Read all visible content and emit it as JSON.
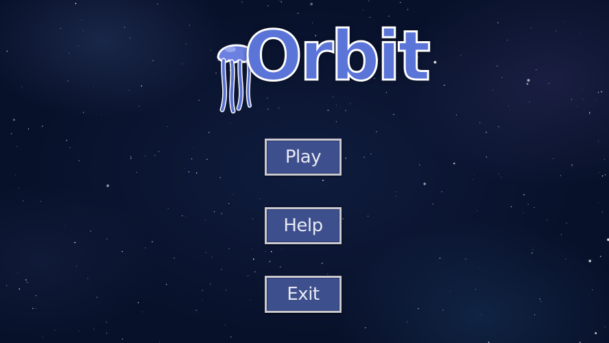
{
  "game": {
    "title": "Orbit"
  },
  "menu": {
    "play_label": "Play",
    "help_label": "Help",
    "exit_label": "Exit"
  },
  "colors": {
    "background": "#0b1430",
    "button_fill": "#3e4f8e",
    "button_border": "#c9c9cf",
    "logo_fill": "#5a74d8"
  },
  "icons": {
    "logo_mascot": "jellyfish-icon"
  }
}
